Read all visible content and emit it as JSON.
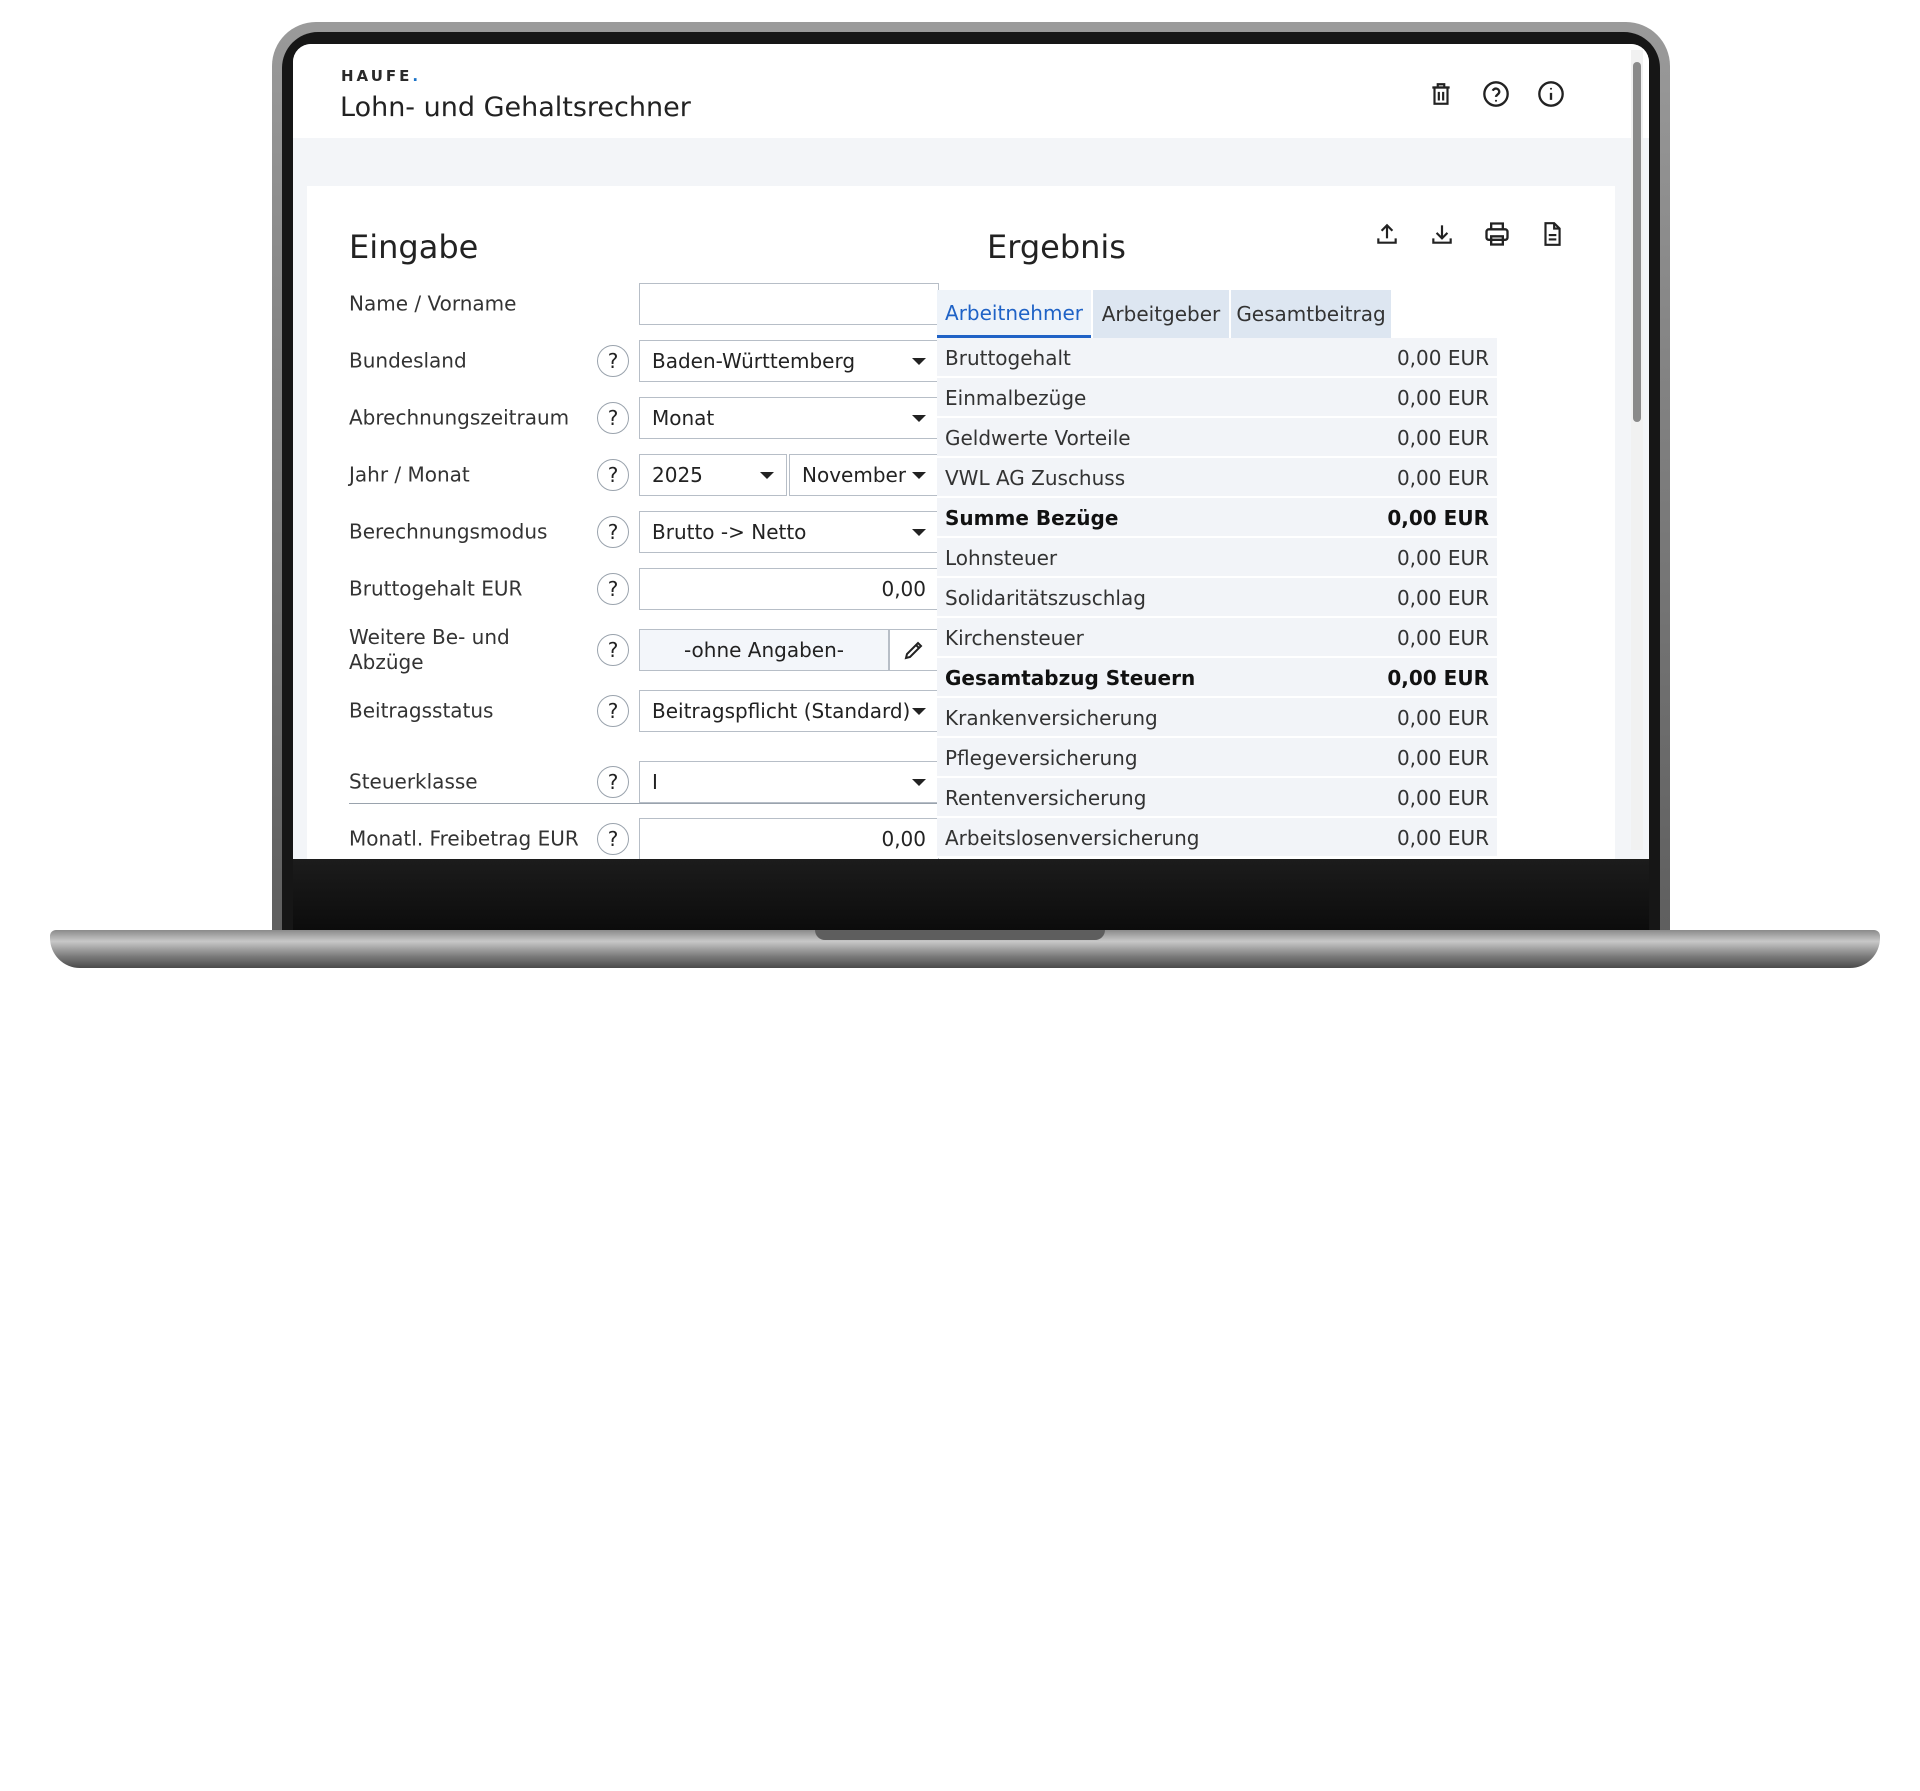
{
  "header": {
    "brand": "HAUFE",
    "brand_dot": ".",
    "title": "Lohn- und Gehaltsrechner",
    "icons": [
      "trash-icon",
      "help-circle-icon",
      "info-circle-icon"
    ]
  },
  "input": {
    "title": "Eingabe",
    "fields": {
      "name": {
        "label": "Name / Vorname",
        "value": ""
      },
      "bundesland": {
        "label": "Bundesland",
        "value": "Baden-Württemberg"
      },
      "abrechnungszeitraum": {
        "label": "Abrechnungszeitraum",
        "value": "Monat"
      },
      "jahr_monat": {
        "label": "Jahr / Monat",
        "jahr": "2025",
        "monat": "November"
      },
      "berechnungsmodus": {
        "label": "Berechnungsmodus",
        "value": "Brutto -> Netto"
      },
      "bruttogehalt": {
        "label": "Bruttogehalt EUR",
        "value": "0,00"
      },
      "weitere": {
        "label": "Weitere Be- und Abzüge",
        "value": "-ohne Angaben-"
      },
      "beitragsstatus": {
        "label": "Beitragsstatus",
        "value": "Beitragspflicht (Standard)"
      },
      "steuerklasse": {
        "label": "Steuerklasse",
        "value": "I"
      },
      "freibetrag": {
        "label": "Monatl. Freibetrag EUR",
        "value": "0,00"
      }
    },
    "help_symbol": "?"
  },
  "result": {
    "title": "Ergebnis",
    "actions": [
      "upload-icon",
      "download-icon",
      "print-icon",
      "document-icon"
    ],
    "tabs": [
      "Arbeitnehmer",
      "Arbeitgeber",
      "Gesamtbeitrag"
    ],
    "active_tab": "Arbeitnehmer",
    "rows": [
      {
        "label": "Bruttogehalt",
        "value": "0,00 EUR"
      },
      {
        "label": "Einmalbezüge",
        "value": "0,00 EUR"
      },
      {
        "label": "Geldwerte Vorteile",
        "value": "0,00 EUR"
      },
      {
        "label": "VWL AG Zuschuss",
        "value": "0,00 EUR"
      },
      {
        "label": "Summe Bezüge",
        "value": "0,00 EUR"
      },
      {
        "label": "Lohnsteuer",
        "value": "0,00 EUR"
      },
      {
        "label": "Solidaritätszuschlag",
        "value": "0,00 EUR"
      },
      {
        "label": "Kirchensteuer",
        "value": "0,00 EUR"
      },
      {
        "label": "Gesamtabzug Steuern",
        "value": "0,00 EUR"
      },
      {
        "label": "Krankenversicherung",
        "value": "0,00 EUR"
      },
      {
        "label": "Pflegeversicherung",
        "value": "0,00 EUR"
      },
      {
        "label": "Rentenversicherung",
        "value": "0,00 EUR"
      },
      {
        "label": "Arbeitslosenversicherung",
        "value": "0,00 EUR"
      }
    ]
  },
  "colors": {
    "accent": "#1f62c6",
    "tab_bg": "#dde6f1",
    "row_bg": "#f2f4f8"
  }
}
